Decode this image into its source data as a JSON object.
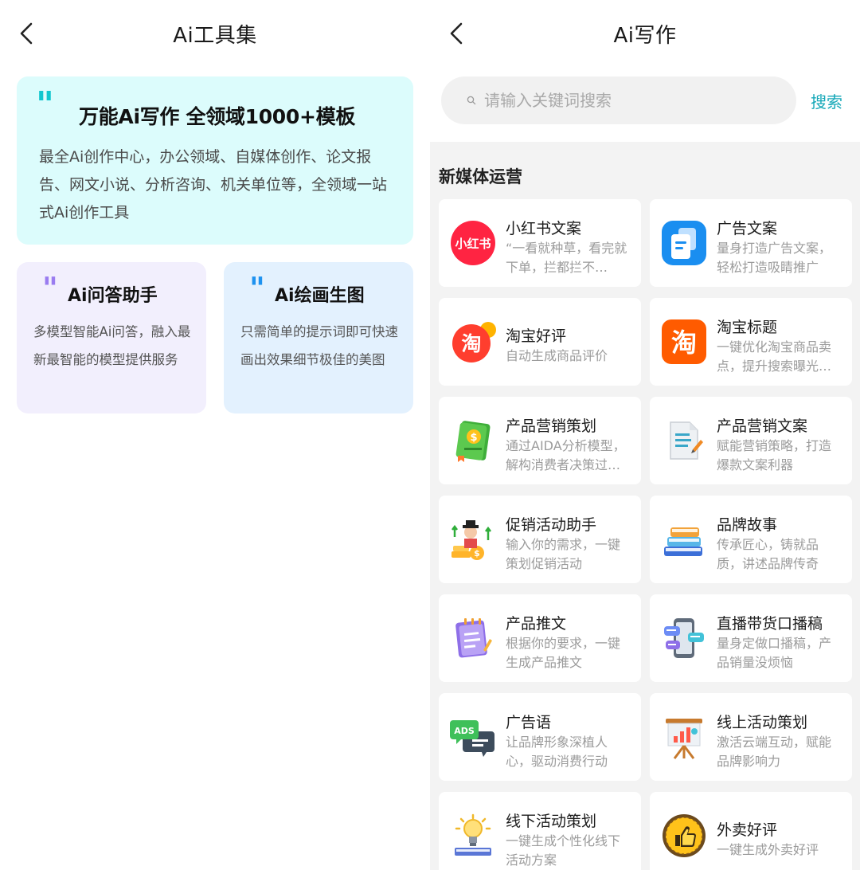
{
  "left": {
    "title": "Ai工具集",
    "hero": {
      "quote_mark": "\"",
      "title": "万能Ai写作 全领域1000+模板",
      "desc": "最全Ai创作中心，办公领域、自媒体创作、论文报告、网文小说、分析咨询、机关单位等，全领域一站式Ai创作工具"
    },
    "qa": {
      "quote_mark": "\"",
      "title": "Ai问答助手",
      "desc": "多模型智能Ai问答，融入最新最智能的模型提供服务"
    },
    "draw": {
      "quote_mark": "\"",
      "title": "Ai绘画生图",
      "desc": "只需简单的提示词即可快速画出效果细节极佳的美图"
    }
  },
  "right": {
    "title": "Ai写作",
    "search": {
      "placeholder": "请输入关键词搜索",
      "button": "搜索"
    },
    "section_title": "新媒体运营",
    "cards": [
      {
        "icon": "xiaohongshu-icon",
        "title": "小红书文案",
        "desc": "“一看就种草，看完就下单，拦都拦不…"
      },
      {
        "icon": "ad-copy-icon",
        "title": "广告文案",
        "desc": "量身打造广告文案，轻松打造吸睛推广"
      },
      {
        "icon": "taobao-review-icon",
        "title": "淘宝好评",
        "desc": "自动生成商品评价"
      },
      {
        "icon": "taobao-title-icon",
        "title": "淘宝标题",
        "desc": "一键优化淘宝商品卖点，提升搜索曝光…"
      },
      {
        "icon": "marketing-plan-icon",
        "title": "产品营销策划",
        "desc": "通过AIDA分析模型，解构消费者决策过…"
      },
      {
        "icon": "marketing-copy-icon",
        "title": "产品营销文案",
        "desc": "赋能营销策略，打造爆款文案利器"
      },
      {
        "icon": "promo-assistant-icon",
        "title": "促销活动助手",
        "desc": "输入你的需求，一键策划促销活动"
      },
      {
        "icon": "brand-story-icon",
        "title": "品牌故事",
        "desc": "传承匠心，铸就品质，讲述品牌传奇"
      },
      {
        "icon": "product-post-icon",
        "title": "产品推文",
        "desc": "根据你的要求，一键生成产品推文"
      },
      {
        "icon": "livestream-script-icon",
        "title": "直播带货口播稿",
        "desc": "量身定做口播稿，产品销量没烦恼"
      },
      {
        "icon": "ads-slogan-icon",
        "title": "广告语",
        "desc": "让品牌形象深植人心，驱动消费行动"
      },
      {
        "icon": "online-event-icon",
        "title": "线上活动策划",
        "desc": "激活云端互动，赋能品牌影响力"
      },
      {
        "icon": "offline-event-icon",
        "title": "线下活动策划",
        "desc": "一键生成个性化线下活动方案"
      },
      {
        "icon": "takeaway-review-icon",
        "title": "外卖好评",
        "desc": "一键生成外卖好评"
      }
    ]
  },
  "colors": {
    "accent": "#16a8b8",
    "hero_bg": "#dcfcfc",
    "qa_bg": "#f2effd",
    "draw_bg": "#e3f1fe",
    "grid_bg": "#f3f3f3"
  }
}
